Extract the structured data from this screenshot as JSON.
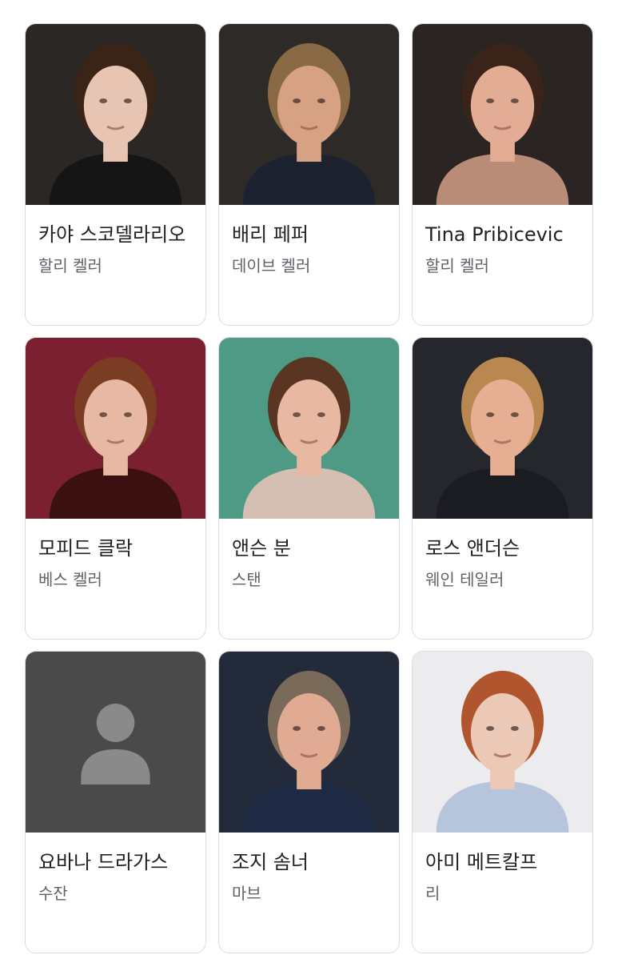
{
  "cards": [
    {
      "name": "카야 스코델라리오",
      "role": "할리 켈러",
      "photo": "actor-photo",
      "colors": {
        "bg": "#2a2725",
        "skin": "#e8c4b2",
        "hair": "#3a2418",
        "cloth": "#151515"
      }
    },
    {
      "name": "배리 페퍼",
      "role": "데이브 켈러",
      "photo": "actor-photo",
      "colors": {
        "bg": "#2d2a28",
        "skin": "#d7a184",
        "hair": "#8a6a44",
        "cloth": "#1d2230"
      }
    },
    {
      "name": "Tina Pribicevic",
      "role": "할리 켈러",
      "photo": "actor-photo",
      "colors": {
        "bg": "#2a2522",
        "skin": "#e2ad94",
        "hair": "#3a2318",
        "cloth": "#b98c78"
      }
    },
    {
      "name": "모피드 클락",
      "role": "베스 켈러",
      "photo": "actor-photo",
      "colors": {
        "bg": "#7a2030",
        "skin": "#e7b8a4",
        "hair": "#7a3c22",
        "cloth": "#3a1010"
      }
    },
    {
      "name": "앤슨 분",
      "role": "스탠",
      "photo": "actor-photo",
      "colors": {
        "bg": "#4f9a84",
        "skin": "#e9b8a2",
        "hair": "#5a3522",
        "cloth": "#d4bfb2"
      }
    },
    {
      "name": "로스 앤더슨",
      "role": "웨인 테일러",
      "photo": "actor-photo",
      "colors": {
        "bg": "#26272d",
        "skin": "#e6ae92",
        "hair": "#b98850",
        "cloth": "#1b1b22"
      }
    },
    {
      "name": "요바나 드라가스",
      "role": "수잔",
      "photo": "placeholder-person-icon",
      "colors": {
        "bg": "#4a4a4a",
        "skin": "#8a8a8a",
        "hair": "#8a8a8a",
        "cloth": "#8a8a8a"
      }
    },
    {
      "name": "조지 솜너",
      "role": "마브",
      "photo": "actor-photo",
      "colors": {
        "bg": "#232a3a",
        "skin": "#e0ab92",
        "hair": "#7a6a5a",
        "cloth": "#1e2a44"
      }
    },
    {
      "name": "아미 메트칼프",
      "role": "리",
      "photo": "actor-photo",
      "colors": {
        "bg": "#ececee",
        "skin": "#ecc8b6",
        "hair": "#b0552e",
        "cloth": "#b6c4dc"
      }
    }
  ]
}
